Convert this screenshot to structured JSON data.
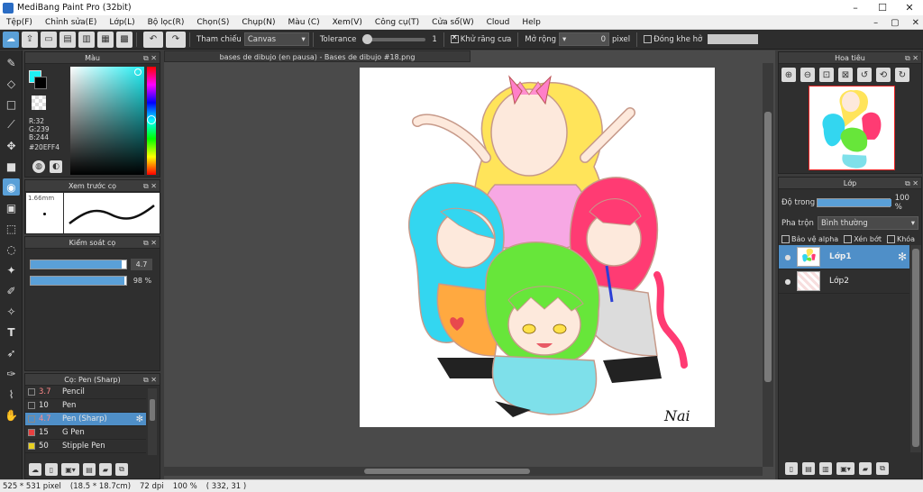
{
  "window": {
    "title": "MediBang Paint Pro (32bit)",
    "minimize": "–",
    "maximize": "☐",
    "close": "✕"
  },
  "menu": {
    "items": [
      "Tệp(F)",
      "Chỉnh sửa(E)",
      "Lớp(L)",
      "Bộ lọc(R)",
      "Chọn(S)",
      "Chụp(N)",
      "Màu (C)",
      "Xem(V)",
      "Công cụ(T)",
      "Cửa sổ(W)",
      "Cloud",
      "Help"
    ],
    "right": [
      "–",
      "▢",
      "✕"
    ]
  },
  "toolbar": {
    "reference_label": "Tham chiếu",
    "reference_value": "Canvas",
    "tolerance_label": "Tolerance",
    "tolerance_value": "1",
    "antialias_label": "Khử răng cưa",
    "expand_label": "Mở rộng",
    "expand_value": "0",
    "expand_unit": "pixel",
    "close_gap_label": "Đóng khe hở"
  },
  "color_panel": {
    "title": "Màu",
    "r": "R:32",
    "g": "G:239",
    "b": "B:244",
    "hex": "#20EFF4",
    "fg_color": "#20EFF4"
  },
  "brush_preview": {
    "title": "Xem trước cọ",
    "size": "1.66mm"
  },
  "brush_control": {
    "title": "Kiểm soát cọ",
    "size_value": "4.7",
    "opacity_value": "98 %",
    "opacity_level": 0.98,
    "size_level": 0.95
  },
  "brush_list": {
    "title": "Cọ: Pen (Sharp)",
    "items": [
      {
        "size": "3.7",
        "name": "Pencil",
        "color": "#2b2b2b"
      },
      {
        "size": "10",
        "name": "Pen",
        "color": "#2b2b2b"
      },
      {
        "size": "4.7",
        "name": "Pen (Sharp)",
        "color": "#2b2b2b"
      },
      {
        "size": "15",
        "name": "G Pen",
        "color": "#e84040"
      },
      {
        "size": "50",
        "name": "Stipple Pen",
        "color": "#e8d020"
      }
    ]
  },
  "document": {
    "tab": "bases de dibujo (en pausa) - Bases de dibujo #18.png",
    "signature": "Nai"
  },
  "navigator": {
    "title": "Hoa tiêu"
  },
  "layers": {
    "title": "Lớp",
    "opacity_label": "Độ trong",
    "opacity_value": "100 %",
    "opacity_level": 1.0,
    "blend_label": "Pha trộn",
    "blend_value": "Bình thường",
    "protect_alpha": "Bảo vệ alpha",
    "clipping": "Xén bớt",
    "lock": "Khóa",
    "items": [
      {
        "name": "Lớp1"
      },
      {
        "name": "Lớp2"
      }
    ]
  },
  "status": {
    "size": "525 * 531 pixel",
    "physical": "(18.5 * 18.7cm)",
    "dpi": "72 dpi",
    "zoom": "100 %",
    "coords": "( 332, 31 )"
  },
  "colors": {
    "accent": "#4f8fc8",
    "dark": "#2f2f2f"
  }
}
